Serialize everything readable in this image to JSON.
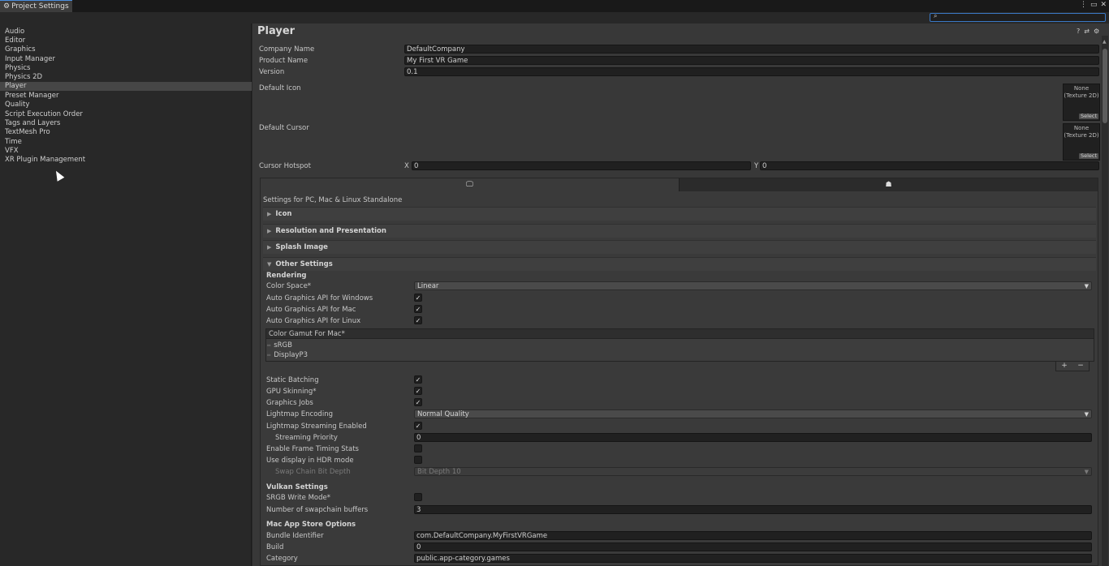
{
  "window": {
    "tab_title": "Project Settings",
    "controls": [
      "⋮",
      "▭",
      "✕"
    ]
  },
  "sidebar": {
    "items": [
      {
        "label": "Audio"
      },
      {
        "label": "Editor"
      },
      {
        "label": "Graphics"
      },
      {
        "label": "Input Manager"
      },
      {
        "label": "Physics"
      },
      {
        "label": "Physics 2D"
      },
      {
        "label": "Player"
      },
      {
        "label": "Preset Manager"
      },
      {
        "label": "Quality"
      },
      {
        "label": "Script Execution Order"
      },
      {
        "label": "Tags and Layers"
      },
      {
        "label": "TextMesh Pro"
      },
      {
        "label": "Time"
      },
      {
        "label": "VFX"
      },
      {
        "label": "XR Plugin Management"
      }
    ],
    "selected": "Player"
  },
  "header": {
    "title": "Player",
    "icons": [
      "help-icon",
      "presets-icon",
      "settings-icon"
    ]
  },
  "general": {
    "company_name_label": "Company Name",
    "company_name": "DefaultCompany",
    "product_name_label": "Product Name",
    "product_name": "My First VR Game",
    "version_label": "Version",
    "version": "0.1",
    "default_icon_label": "Default Icon",
    "default_cursor_label": "Default Cursor",
    "texture_none_line1": "None",
    "texture_none_line2": "(Texture 2D)",
    "select_label": "Select",
    "cursor_hotspot_label": "Cursor Hotspot",
    "hotspot_x_label": "X",
    "hotspot_x": "0",
    "hotspot_y_label": "Y",
    "hotspot_y": "0"
  },
  "platforms": {
    "tabs": [
      {
        "icon": "monitor-icon",
        "selected": true
      },
      {
        "icon": "android-icon",
        "selected": false
      }
    ],
    "settings_for": "Settings for PC, Mac & Linux Standalone"
  },
  "foldouts": {
    "icon": "Icon",
    "resolution": "Resolution and Presentation",
    "splash": "Splash Image",
    "other": "Other Settings"
  },
  "rendering": {
    "section": "Rendering",
    "color_space_label": "Color Space*",
    "color_space": "Linear",
    "auto_win_label": "Auto Graphics API  for Windows",
    "auto_win": true,
    "auto_mac_label": "Auto Graphics API  for Mac",
    "auto_mac": true,
    "auto_linux_label": "Auto Graphics API  for Linux",
    "auto_linux": true,
    "color_gamut_label": "Color Gamut For Mac*",
    "color_gamut_items": [
      "sRGB",
      "DisplayP3"
    ],
    "add_btn": "+",
    "remove_btn": "−",
    "static_batching_label": "Static Batching",
    "static_batching": true,
    "gpu_skinning_label": "GPU Skinning*",
    "gpu_skinning": true,
    "graphics_jobs_label": "Graphics Jobs",
    "graphics_jobs": true,
    "lightmap_encoding_label": "Lightmap Encoding",
    "lightmap_encoding": "Normal Quality",
    "lightmap_streaming_label": "Lightmap Streaming Enabled",
    "lightmap_streaming": true,
    "streaming_priority_label": "Streaming Priority",
    "streaming_priority": "0",
    "frame_timing_label": "Enable Frame Timing Stats",
    "frame_timing": false,
    "hdr_label": "Use display in HDR mode",
    "hdr": false,
    "swap_chain_label": "Swap Chain Bit Depth",
    "swap_chain": "Bit Depth 10"
  },
  "vulkan": {
    "section": "Vulkan Settings",
    "srgb_label": "SRGB Write Mode*",
    "srgb": false,
    "swapchain_buffers_label": "Number of swapchain buffers",
    "swapchain_buffers": "3"
  },
  "macstore": {
    "section": "Mac App Store Options",
    "bundle_label": "Bundle Identifier",
    "bundle": "com.DefaultCompany.MyFirstVRGame",
    "build_label": "Build",
    "build": "0",
    "category_label": "Category",
    "category": "public.app-category.games"
  },
  "colors": {
    "accent": "#3a79c6",
    "panel": "#383838",
    "sidebar": "#282828",
    "selection": "#464646"
  }
}
